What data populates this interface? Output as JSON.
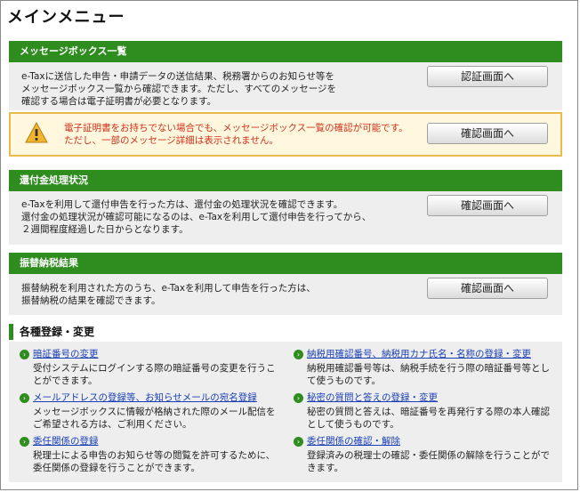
{
  "page_title": "メインメニュー",
  "message_box": {
    "heading": "メッセージボックス一覧",
    "text_lines": [
      "e-Taxに送信した申告・申請データの送信結果、税務署からのお知らせ等を",
      "メッセージボックス一覧から確認できます。ただし、すべてのメッセージを",
      "確認する場合は電子証明書が必要となります。"
    ],
    "button_label": "認証画面へ",
    "warning_lines": [
      "電子証明書をお持ちでない場合でも、メッセージボックス一覧の確認が可能です。",
      "ただし、一部のメッセージ詳細は表示されません。"
    ],
    "warning_button_label": "確認画面へ",
    "warning_icon": "warning-triangle-icon",
    "warning_color": "#d0301a"
  },
  "refund": {
    "heading": "還付金処理状況",
    "text_lines": [
      "e-Taxを利用して還付申告を行った方は、還付金の処理状況を確認できます。",
      "還付金の処理状況が確認可能になるのは、e-Taxを利用して還付申告を行ってから、",
      "２週間程度経過した日からとなります。"
    ],
    "button_label": "確認画面へ"
  },
  "transfer": {
    "heading": "振替納税結果",
    "text_lines": [
      "振替納税を利用された方のうち、e-Taxを利用して申告を行った方は、",
      "振替納税の結果を確認できます。"
    ],
    "button_label": "確認画面へ"
  },
  "registration": {
    "heading": "各種登録・変更",
    "items": [
      {
        "link": "暗証番号の変更",
        "desc": [
          "受付システムにログインする際の暗証番号の変更を行うこ",
          "とができます。"
        ]
      },
      {
        "link": "納税用確認番号、納税用カナ氏名・名称の登録・変更",
        "desc": [
          "納税用確認番号等は、納税手続を行う際の暗証番号等とし",
          "て使うものです。"
        ]
      },
      {
        "link": "メールアドレスの登録等、お知らせメールの宛名登録",
        "desc": [
          "メッセージボックスに情報が格納された際のメール配信を",
          "ご希望される方は、ご利用ください。"
        ]
      },
      {
        "link": "秘密の質問と答えの登録・変更",
        "desc": [
          "秘密の質問と答えは、暗証番号を再発行する際の本人確認",
          "として使うものです。"
        ]
      },
      {
        "link": "委任関係の登録",
        "desc": [
          "税理士による申告のお知らせ等の閲覧を許可するために、",
          "委任関係の登録を行うことができます。"
        ]
      },
      {
        "link": "委任関係の確認・解除",
        "desc": [
          "登録済みの税理士の確認・委任関係の解除を行うことがで",
          "きます。"
        ]
      }
    ]
  },
  "colors": {
    "accent_green": "#2f8c1f",
    "link_blue": "#1a3fb4",
    "warning_border": "#e8bb4a"
  }
}
